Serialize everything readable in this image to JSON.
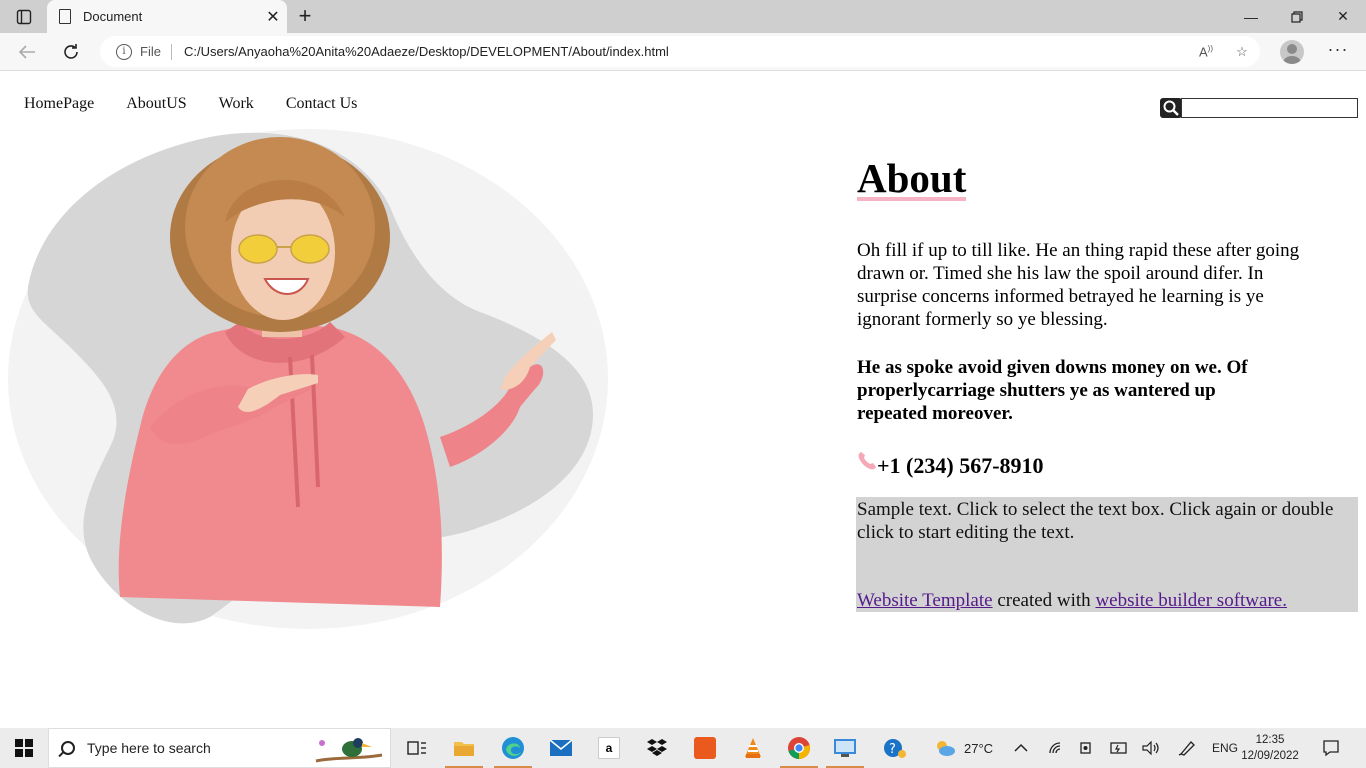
{
  "browser": {
    "tab_title": "Document",
    "address": {
      "scheme_label": "File",
      "url": "C:/Users/Anyaoha%20Anita%20Adaeze/Desktop/DEVELOPMENT/About/index.html"
    }
  },
  "nav": {
    "items": [
      "HomePage",
      "AboutUS",
      "Work",
      "Contact Us"
    ]
  },
  "search": {
    "placeholder": "",
    "value": ""
  },
  "about": {
    "heading": "About",
    "paragraph": "Oh fill if up to till like. He an thing rapid these after going drawn or. Timed she his law the spoil around difer. In surprise concerns informed betrayed he learning is ye ignorant formerly so ye blessing.",
    "bold_paragraph": "He as spoke avoid given downs money on we. Of properlycarriage shutters ye as wantered up repeated moreover.",
    "phone": "+1 (234) 567-8910"
  },
  "sample": {
    "text": "Sample text. Click to select the text box. Click again or double click to start editing the text.",
    "link1": "Website Template",
    "middle": " created with ",
    "link2": "website builder software."
  },
  "taskbar": {
    "search_placeholder": "Type here to search",
    "weather": "27°C",
    "language": "ENG",
    "time": "12:35",
    "date": "12/09/2022"
  },
  "colors": {
    "heading_underline": "#f5b3c4",
    "hoodie_pink": "#f08a8e",
    "sample_box_bg": "#d3d3d3",
    "link_visited": "#551a8b"
  }
}
